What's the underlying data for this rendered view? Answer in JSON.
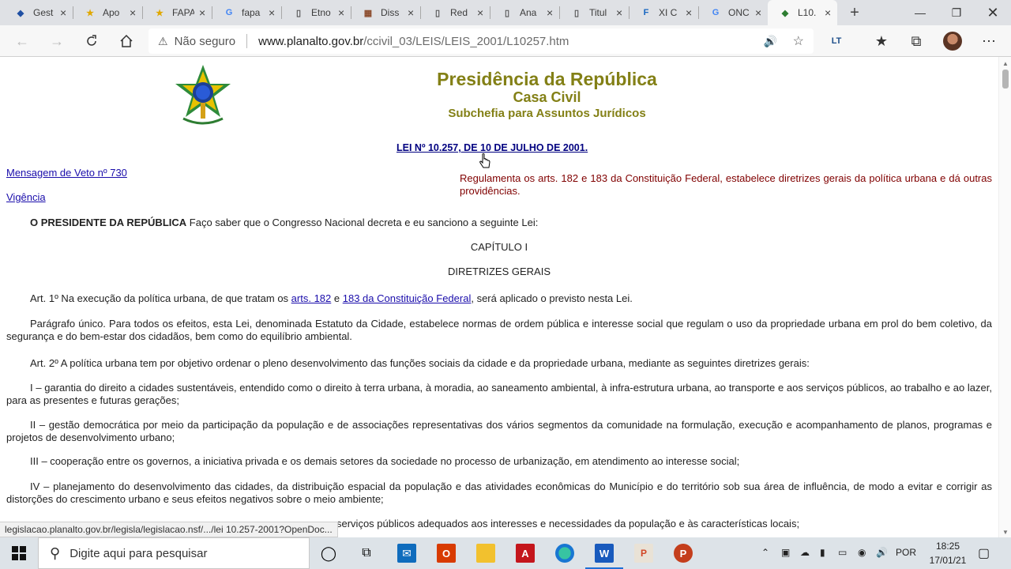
{
  "tabs": [
    {
      "icon": "◆",
      "title": "Gest",
      "color": "#1f4fa3"
    },
    {
      "icon": "★",
      "title": "Apo",
      "color": "#e0a800"
    },
    {
      "icon": "★",
      "title": "FAPA",
      "color": "#e0a800"
    },
    {
      "icon": "G",
      "title": "fapa",
      "color": "#4285f4"
    },
    {
      "icon": "▯",
      "title": "Etno",
      "color": "#555"
    },
    {
      "icon": "▦",
      "title": "Diss",
      "color": "#8b4a2b"
    },
    {
      "icon": "▯",
      "title": "Red",
      "color": "#555"
    },
    {
      "icon": "▯",
      "title": "Ana",
      "color": "#555"
    },
    {
      "icon": "▯",
      "title": "Titul",
      "color": "#555"
    },
    {
      "icon": "F",
      "title": "XI C",
      "color": "#1565c0"
    },
    {
      "icon": "G",
      "title": "ONC",
      "color": "#4285f4"
    },
    {
      "icon": "◆",
      "title": "L10.",
      "color": "#2e7d32"
    }
  ],
  "browser": {
    "not_secure": "Não seguro",
    "url_host": "www.planalto.gov.br",
    "url_path": "/ccivil_03/LEIS/LEIS_2001/L10257.htm",
    "profile_initials": "",
    "ext_badge": "LT"
  },
  "header": {
    "line1": "Presidência da República",
    "line2": "Casa Civil",
    "line3": "Subchefia para Assuntos Jurídicos"
  },
  "law_title": "LEI Nº 10.257, DE 10 DE JULHO DE 2001.",
  "links": {
    "veto": "Mensagem de Veto nº 730",
    "vigencia": "Vigência"
  },
  "ementa": "Regulamenta os arts. 182 e 183 da Constituição Federal, estabelece diretrizes gerais da política urbana e dá outras providências.",
  "preamble_bold": "O PRESIDENTE DA REPÚBLICA",
  "preamble_rest": " Faço saber que o Congresso Nacional decreta e eu sanciono a seguinte Lei:",
  "chapter": "CAPÍTULO I",
  "chapter_title": "DIRETRIZES GERAIS",
  "art1": {
    "prefix": "Art. 1º Na execução da política urbana, de que tratam os ",
    "link1": "arts. 182",
    "mid": " e ",
    "link2": "183 da Constituição Federal",
    "suffix": ", será aplicado o previsto nesta Lei."
  },
  "paragrafo_unico": "Parágrafo único. Para todos os efeitos, esta Lei, denominada Estatuto da Cidade, estabelece normas de ordem pública e interesse social que regulam o uso da propriedade urbana em prol do bem coletivo, da segurança e do bem-estar dos cidadãos, bem como do equilíbrio ambiental.",
  "art2": "Art. 2º A política urbana tem por objetivo ordenar o pleno desenvolvimento das funções sociais da cidade e da propriedade urbana, mediante as seguintes diretrizes gerais:",
  "inc1": "I – garantia do direito a cidades sustentáveis, entendido como o direito à terra urbana, à moradia, ao saneamento ambiental, à infra-estrutura urbana, ao transporte e aos serviços públicos, ao trabalho e ao lazer, para as presentes e futuras gerações;",
  "inc2": "II – gestão democrática por meio da participação da população e de associações representativas dos vários segmentos da comunidade na formulação, execução e acompanhamento de planos, programas e projetos de desenvolvimento urbano;",
  "inc3": "III – cooperação entre os governos, a iniciativa privada e os demais setores da sociedade no processo de urbanização, em atendimento ao interesse social;",
  "inc4": "IV – planejamento do desenvolvimento das cidades, da distribuição espacial da população e das atividades econômicas do Município e do território sob sua área de influência, de modo a evitar e corrigir as distorções do crescimento urbano e seus efeitos negativos sobre o meio ambiente;",
  "inc5_partial": "serviços públicos adequados aos interesses e necessidades da população e às características locais;",
  "status_url": "legislacao.planalto.gov.br/legisla/legislacao.nsf/.../lei 10.257-2001?OpenDoc...",
  "taskbar": {
    "search_placeholder": "Digite aqui para pesquisar",
    "lang": "POR",
    "time": "18:25",
    "date": "17/01/21"
  }
}
